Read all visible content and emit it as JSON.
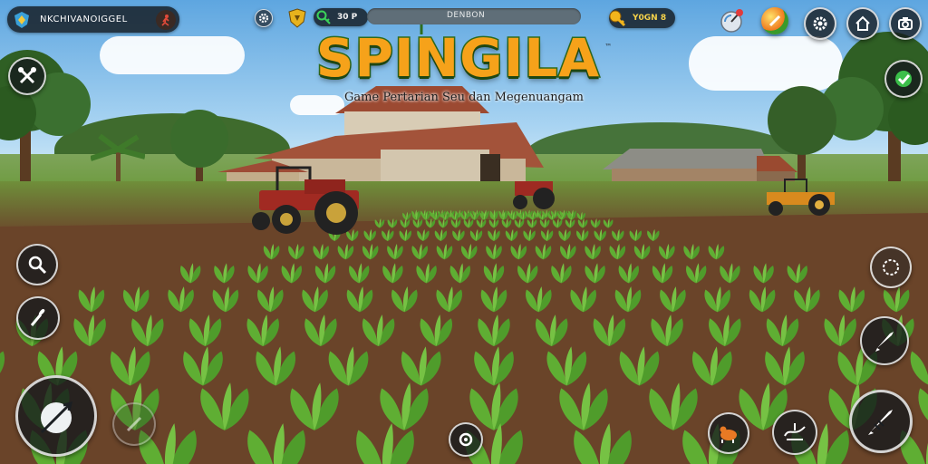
{
  "game": {
    "logo_text": "SPINGILA",
    "logo_mark": "™",
    "subtitle": "Game Pertarian Seu dan Megenuangam"
  },
  "hud": {
    "player_name": "NKCHIVANOIGGEL",
    "energy_value": "30 P",
    "level_bar_label": "DENBON",
    "level_progress": 0.0,
    "coins_value": "Y0GN 8"
  },
  "icons": {
    "profile_badge": "shield-badge-icon",
    "player_avatar": "runner-avatar-icon",
    "settings_small": "gear-icon",
    "shield": "shield-icon",
    "energy": "key-icon",
    "coins": "gold-key-icon",
    "radar": "radar-dish-icon",
    "boost": "boost-orb-icon",
    "settings": "gear-icon",
    "home": "home-icon",
    "camera": "camera-icon",
    "tools": "tools-icon",
    "check": "checkmark-icon",
    "search": "magnifier-icon",
    "sickle": "sickle-icon",
    "joystick": "joystick-icon",
    "ghost_action": "hoe-icon",
    "center_action": "center-dot-icon",
    "animal": "animal-icon",
    "map": "map-icon",
    "compass": "compass-icon",
    "rocket": "rocket-icon",
    "rocket_big": "rocket-icon"
  },
  "colors": {
    "accent_green": "#2f6d1e",
    "accent_orange": "#f6a21a",
    "hud_dark": "#141a20"
  }
}
